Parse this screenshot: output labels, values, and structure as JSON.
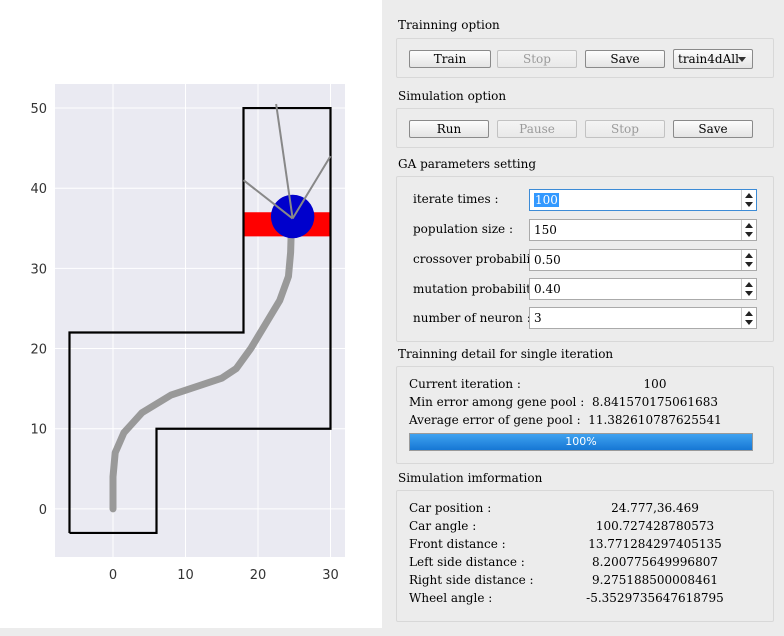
{
  "plot": {
    "x_ticks": [
      "0",
      "10",
      "20",
      "30"
    ],
    "y_ticks": [
      "0",
      "10",
      "20",
      "30",
      "40",
      "50"
    ],
    "xlim": [
      -8,
      32
    ],
    "ylim": [
      -6,
      53
    ],
    "track_outline": [
      [
        -6,
        -3
      ],
      [
        6,
        -3
      ],
      [
        6,
        10
      ],
      [
        30,
        10
      ],
      [
        30,
        50
      ],
      [
        18,
        50
      ],
      [
        18,
        22
      ],
      [
        -6,
        22
      ],
      [
        -6,
        -3
      ]
    ],
    "finish_zone": {
      "x_from": 18,
      "x_to": 30,
      "y_from": 34,
      "y_to": 37,
      "color": "#ff0000"
    },
    "car": {
      "x": 24.777,
      "y": 36.469,
      "radius": 3,
      "color": "#0000cc"
    },
    "sensor_rays": [
      [
        30,
        44
      ],
      [
        18,
        41
      ],
      [
        22.5,
        50.5
      ]
    ],
    "path": [
      [
        0,
        0
      ],
      [
        0,
        4
      ],
      [
        0.3,
        7
      ],
      [
        1.5,
        9.5
      ],
      [
        4,
        12
      ],
      [
        8,
        14.2
      ],
      [
        12,
        15.4
      ],
      [
        15,
        16.3
      ],
      [
        17,
        17.5
      ],
      [
        19,
        20
      ],
      [
        21,
        23
      ],
      [
        23,
        26
      ],
      [
        24.2,
        29
      ],
      [
        24.5,
        32
      ],
      [
        24.6,
        35
      ],
      [
        24.8,
        36.5
      ]
    ],
    "path_color": "#999999",
    "ray_color": "#888888"
  },
  "training": {
    "title": "Trainning option",
    "train_label": "Train",
    "stop_label": "Stop",
    "save_label": "Save",
    "dataset_selected": "train4dAll"
  },
  "simulation": {
    "title": "Simulation option",
    "run_label": "Run",
    "pause_label": "Pause",
    "stop_label": "Stop",
    "save_label": "Save"
  },
  "ga": {
    "title": "GA parameters setting",
    "params": [
      {
        "label": "iterate times :",
        "value": "100"
      },
      {
        "label": "population size :",
        "value": "150"
      },
      {
        "label": "crossover probability :",
        "value": "0.50"
      },
      {
        "label": "mutation probability :",
        "value": "0.40"
      },
      {
        "label": "number of neuron :",
        "value": "3"
      }
    ]
  },
  "detail": {
    "title": "Trainning detail for single iteration",
    "rows": [
      {
        "label": "Current iteration :",
        "value": "100"
      },
      {
        "label": "Min error among gene pool :",
        "value": "8.841570175061683"
      },
      {
        "label": "Average error of gene pool :",
        "value": "11.382610787625541"
      }
    ],
    "progress_percent": 100,
    "progress_text": "100%"
  },
  "siminfo": {
    "title": "Simulation imformation",
    "rows": [
      {
        "label": "Car position :",
        "value": "24.777,36.469"
      },
      {
        "label": "Car angle :",
        "value": "100.727428780573"
      },
      {
        "label": "Front distance :",
        "value": "13.771284297405135"
      },
      {
        "label": "Left side distance :",
        "value": "8.200775649996807"
      },
      {
        "label": "Right side distance :",
        "value": "9.275188500008461"
      },
      {
        "label": "Wheel angle :",
        "value": "-5.3529735647618795"
      }
    ]
  }
}
